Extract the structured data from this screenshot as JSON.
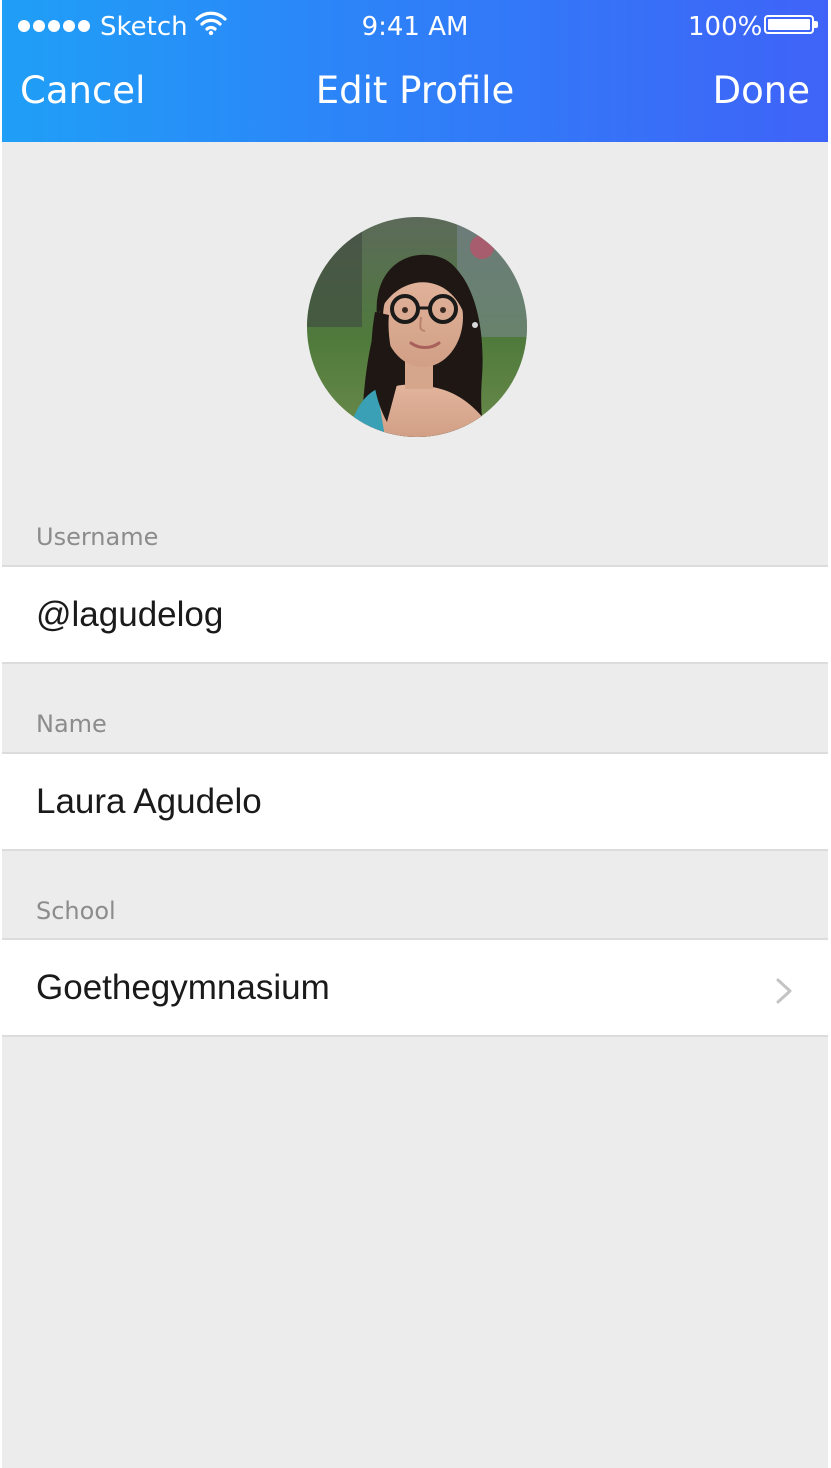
{
  "status_bar": {
    "carrier": "Sketch",
    "time": "9:41 AM",
    "battery": "100%",
    "signal_icon": "signal-dots-icon",
    "wifi_icon": "wifi-icon",
    "battery_icon": "battery-icon"
  },
  "nav": {
    "cancel_label": "Cancel",
    "title": "Edit Profile",
    "done_label": "Done"
  },
  "profile": {
    "avatar_icon": "profile-photo"
  },
  "fields": {
    "username": {
      "label": "Username",
      "value": "@lagudelog"
    },
    "name": {
      "label": "Name",
      "value": "Laura Agudelo"
    },
    "school": {
      "label": "School",
      "value": "Goethegymnasium",
      "accessory_icon": "chevron-right-icon"
    }
  },
  "colors": {
    "nav_gradient_start": "#1f9ff7",
    "nav_gradient_end": "#3f63f8",
    "background": "#ececec",
    "label": "#8c8c8c",
    "text": "#1a1a1a"
  }
}
